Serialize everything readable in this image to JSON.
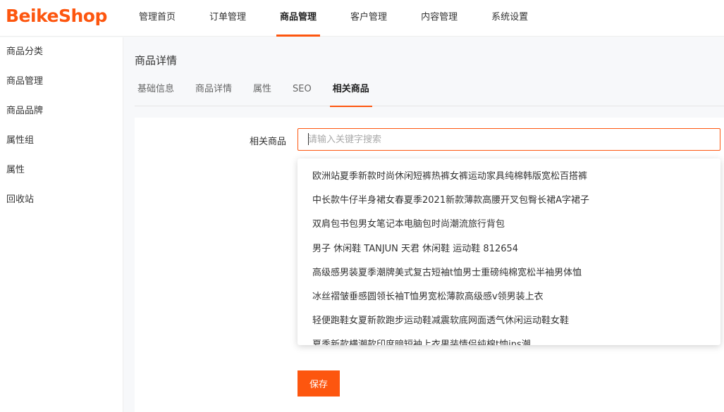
{
  "app": {
    "logo_text": "BeikeShop",
    "brand_color": "#fd560f"
  },
  "nav": {
    "items": [
      {
        "label": "管理首页"
      },
      {
        "label": "订单管理"
      },
      {
        "label": "商品管理",
        "active": true
      },
      {
        "label": "客户管理"
      },
      {
        "label": "内容管理"
      },
      {
        "label": "系统设置"
      }
    ]
  },
  "sidebar": {
    "items": [
      {
        "label": "商品分类"
      },
      {
        "label": "商品管理"
      },
      {
        "label": "商品品牌"
      },
      {
        "label": "属性组"
      },
      {
        "label": "属性"
      },
      {
        "label": "回收站"
      }
    ]
  },
  "page": {
    "title": "商品详情",
    "tabs": [
      {
        "label": "基础信息"
      },
      {
        "label": "商品详情"
      },
      {
        "label": "属性"
      },
      {
        "label": "SEO"
      },
      {
        "label": "相关商品",
        "active": true
      }
    ]
  },
  "form": {
    "related_label": "相关商品",
    "search": {
      "value": "",
      "placeholder": "请输入关键字搜索"
    },
    "suggestions": [
      "欧洲站夏季新款时尚休闲短裤热裤女裤运动家具纯棉韩版宽松百搭裤",
      "中长款牛仔半身裙女春夏季2021新款薄款高腰开叉包臀长裙A字裙子",
      "双肩包书包男女笔记本电脑包时尚潮流旅行背包",
      "男子 休闲鞋 TANJUN 天君 休闲鞋 运动鞋 812654",
      "高级感男装夏季潮牌美式复古短袖t恤男士重磅纯棉宽松半袖男体恤",
      "冰丝褶皱垂感圆领长袖T恤男宽松薄款高级感v领男装上衣",
      "轻便跑鞋女夏新款跑步运动鞋减震软底网面透气休闲运动鞋女鞋",
      "夏季新款横潮款印度暗短袖上衣男装情侣纯棉t恤ins潮"
    ],
    "save_label": "保存"
  }
}
